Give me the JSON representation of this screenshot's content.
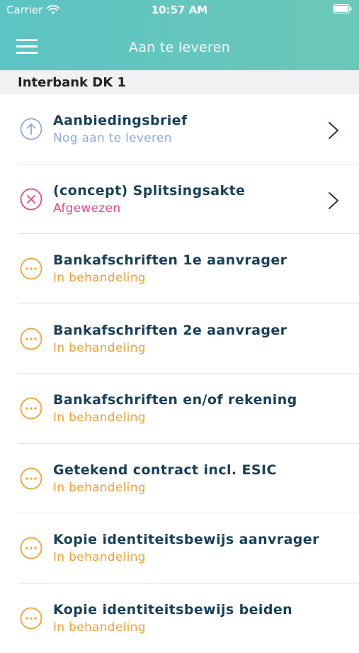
{
  "status_bar": {
    "carrier": "Carrier",
    "time": "10:57 AM"
  },
  "nav": {
    "title": "Aan te leveren"
  },
  "section": {
    "title": "Interbank DK 1"
  },
  "colors": {
    "header_gradient_start": "#5cc4c4",
    "header_gradient_end": "#6cc8b8",
    "title_text": "#17405a",
    "status_upload": "#8fa8e6",
    "status_rejected": "#e8487a",
    "status_pending": "#f0a030"
  },
  "items": [
    {
      "title": "Aanbiedingsbrief",
      "status": "Nog aan te leveren",
      "state": "upload",
      "icon": "upload-arrow-icon",
      "chevron": true
    },
    {
      "title": "(concept) Splitsingsakte",
      "status": "Afgewezen",
      "state": "rejected",
      "icon": "rejected-x-icon",
      "chevron": true
    },
    {
      "title": "Bankafschriften 1e aanvrager",
      "status": "In behandeling",
      "state": "pending",
      "icon": "pending-dots-icon",
      "chevron": false
    },
    {
      "title": "Bankafschriften 2e aanvrager",
      "status": "In behandeling",
      "state": "pending",
      "icon": "pending-dots-icon",
      "chevron": false
    },
    {
      "title": "Bankafschriften en/of rekening",
      "status": "In behandeling",
      "state": "pending",
      "icon": "pending-dots-icon",
      "chevron": false
    },
    {
      "title": "Getekend contract incl. ESIC",
      "status": "In behandeling",
      "state": "pending",
      "icon": "pending-dots-icon",
      "chevron": false
    },
    {
      "title": "Kopie identiteitsbewijs aanvrager",
      "status": "In behandeling",
      "state": "pending",
      "icon": "pending-dots-icon",
      "chevron": false
    },
    {
      "title": "Kopie identiteitsbewijs beiden",
      "status": "In behandeling",
      "state": "pending",
      "icon": "pending-dots-icon",
      "chevron": false
    }
  ]
}
